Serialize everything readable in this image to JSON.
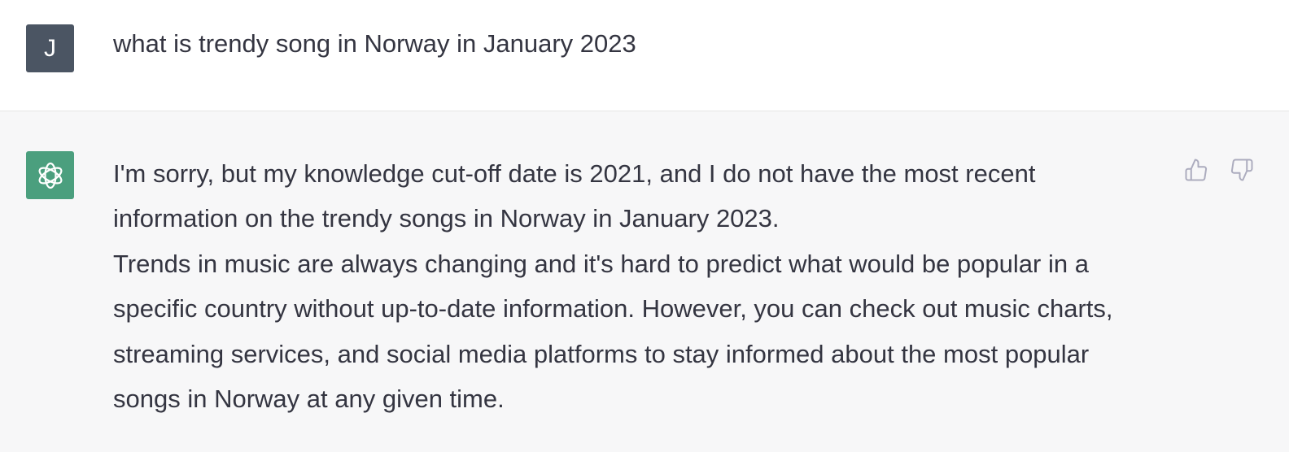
{
  "conversation": {
    "user_message": {
      "avatar_letter": "J",
      "text": "what is trendy song in Norway in January 2023"
    },
    "assistant_message": {
      "paragraphs": [
        "I'm sorry, but my knowledge cut-off date is 2021, and I do not have the most recent information on the trendy songs in Norway in January 2023.",
        "Trends in music are always changing and it's hard to predict what would be popular in a specific country without up-to-date information. However, you can check out music charts, streaming services, and social media platforms to stay informed about the most popular songs in Norway at any given time."
      ],
      "avatar_icon": "openai-logo-icon",
      "feedback_icons": [
        "thumbs-up-icon",
        "thumbs-down-icon"
      ]
    }
  },
  "colors": {
    "user_avatar_bg": "#4b5563",
    "assistant_avatar_bg": "#4b9f7e",
    "assistant_row_bg": "#f7f7f8",
    "text": "#343541",
    "icon": "#acacbe"
  }
}
